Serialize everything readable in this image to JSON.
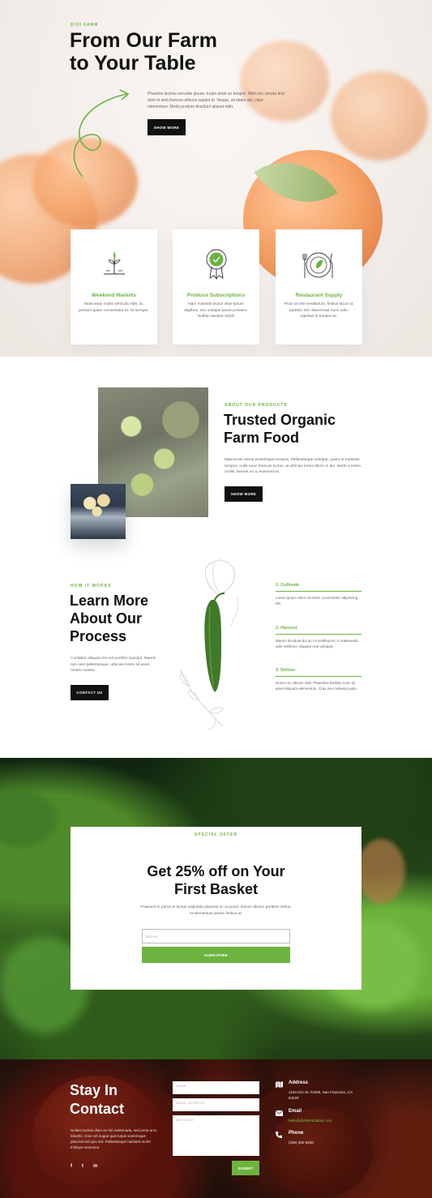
{
  "colors": {
    "accent": "#6cb33f",
    "dark": "#111111",
    "text_muted": "#666666"
  },
  "hero": {
    "eyebrow": "DIVI FARM",
    "title_line1": "From Our Farm",
    "title_line2": "to Your Table",
    "description": "Pharetra lacinia convallis ipsum, turpis amet ac tempor. Nibh nec ornare tinci dunt et sed rhoncus ultrices sapien di. Neque, sit etiam dui, vitae elementum. Morbi pretium tincidunt aliquet nibh.",
    "button": "SHOW MORE"
  },
  "cards": [
    {
      "icon": "seedling-icon",
      "title": "Weekend Markets",
      "text": "Maecenas mollis vehicula nibh, ac pretium quam consectetur et. Ut semper."
    },
    {
      "icon": "award-badge-icon",
      "title": "Produce Subscriptions",
      "text": "Nam molestie lectus vitae ipsum dapibus, nec volutpat purus posuere. Nullam semper turpis"
    },
    {
      "icon": "plate-cutlery-icon",
      "title": "Restaurant Supply",
      "text": "Proin id velit vestibulum, finibus lacus id, porttitor nisi. Maecenas nunc odio, egestas in tempor ac."
    }
  ],
  "about": {
    "eyebrow": "ABOUT OUR PRODUCTS",
    "title_line1": "Trusted Organic",
    "title_line2": "Farm Food",
    "text": "Maecenas varius scelerisque tempus. Pellentesque volutpat, quam et molestie tempus, nulla nunc rhoncus lectus, at ultricies lorem libero in dui. Morbi a lorem mollis, laoreet ex a, euismod ex.",
    "button": "SHOW MORE"
  },
  "process": {
    "eyebrow": "HOW IT WORKS",
    "title_line1": "Learn More",
    "title_line2": "About Our",
    "title_line3": "Process",
    "text": "Curabitur aliquam leo vel porttitor suscipit. Mauris non sem pellentesque, ultricies lorem sit amet, ornare massa.",
    "button": "CONTACT US",
    "steps": [
      {
        "title": "1. Cultivate",
        "text": "Lorem ipsum dolor sit amet, consectetur adipiscing elit."
      },
      {
        "title": "2. Harvest",
        "text": "Mauris tincidunt dui ac mi vestibulum, a malesuada ante eleifend. Aliquam erat volutpat."
      },
      {
        "title": "3. Deliver",
        "text": "Donec ac ultrices velit. Phasellus facilisis nunc sit amet aliquam elementum. Cras nec molestie justo."
      }
    ]
  },
  "offer": {
    "eyebrow": "SPECIAL OFFER",
    "title_line1": "Get 25% off on Your",
    "title_line2": "First Basket",
    "text": "Praesent in purus et lectus vulputate placerat ac ut purus. Donec dictum porttitor metus, et elementum ipsum finibus et.",
    "email_placeholder": "EMAIL",
    "button": "SUBSCRIBE"
  },
  "contact": {
    "title_line1": "Stay In",
    "title_line2": "Contact",
    "text": "Nullam lacinia diam at nisi malesuada, sed porta arcu lobortis. Cras vel augue quis turpis scelerisque placerat vel quis nisi. Pellentesque habitant morbi tristique senectus.",
    "name_placeholder": "NAME",
    "email_placeholder": "EMAIL ADDRESS",
    "message_placeholder": "MESSAGE",
    "button": "SUBMIT",
    "social": [
      "f",
      "t",
      "in"
    ],
    "address_label": "Address",
    "address_value": "1234 Divi St. #1000, San Francisco, CA 94220",
    "email_label": "Email",
    "email_value": "hello@divifarmtotable.com",
    "phone_label": "Phone",
    "phone_value": "(255) 352-6258"
  }
}
